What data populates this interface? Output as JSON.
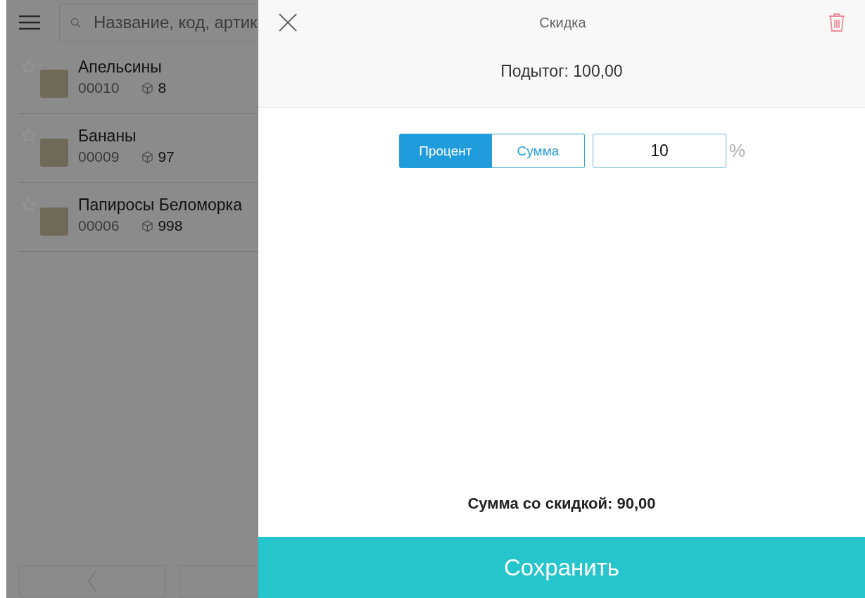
{
  "search": {
    "placeholder": "Название, код, артик"
  },
  "products": [
    {
      "name": "Апельсины",
      "code": "00010",
      "stock": "8",
      "favorite": false
    },
    {
      "name": "Бананы",
      "code": "00009",
      "stock": "97",
      "favorite": false
    },
    {
      "name": "Папиросы Беломорка",
      "code": "00006",
      "stock": "998",
      "favorite": false
    }
  ],
  "discount_panel": {
    "title": "Скидка",
    "subtotal": "Подытог: 100,00",
    "modes": [
      {
        "label": "Процент",
        "selected": true
      },
      {
        "label": "Сумма",
        "selected": false
      }
    ],
    "value": "10",
    "unit": "%",
    "result": "Сумма со скидкой: 90,00",
    "save_button": "Сохранить"
  }
}
